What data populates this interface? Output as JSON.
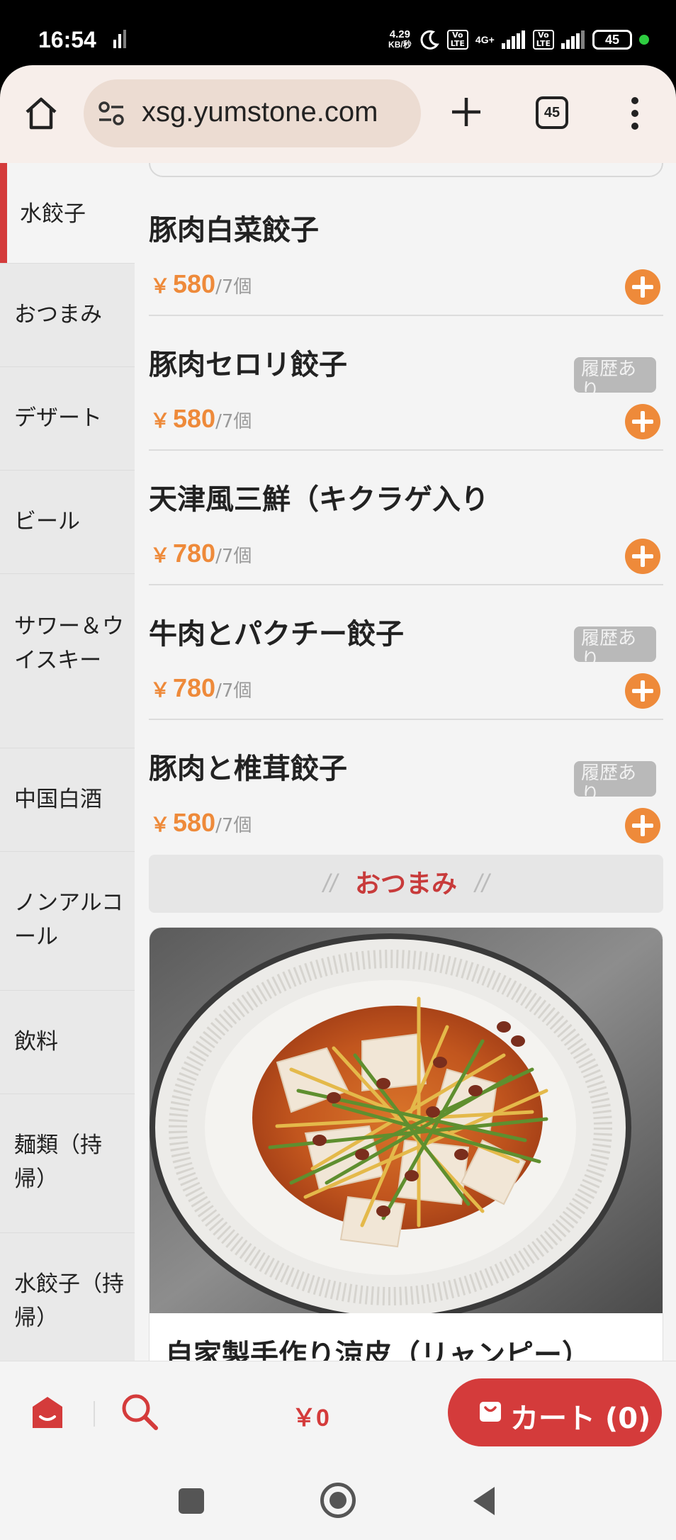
{
  "status_bar": {
    "time": "16:54",
    "net_speed_value": "4.29",
    "net_speed_unit": "KB/秒",
    "lte1": "Vo\nLTE",
    "network": "4G+",
    "lte2": "Vo\nLTE",
    "battery": "45"
  },
  "browser": {
    "url": "xsg.yumstone.com",
    "tab_count": "45"
  },
  "sidebar": {
    "items": [
      {
        "label": "水餃子"
      },
      {
        "label": "おつまみ"
      },
      {
        "label": "デザート"
      },
      {
        "label": "ビール"
      },
      {
        "label": "サワー＆ウイスキー"
      },
      {
        "label": "中国白酒"
      },
      {
        "label": "ノンアルコール"
      },
      {
        "label": "飲料"
      },
      {
        "label": "麺類（持帰）"
      },
      {
        "label": "水餃子（持帰）"
      }
    ]
  },
  "menu": {
    "currency": "￥",
    "items": [
      {
        "name": "豚肉白菜餃子",
        "price": "580",
        "unit": "/7個",
        "badge": ""
      },
      {
        "name": "豚肉セロリ餃子",
        "price": "580",
        "unit": "/7個",
        "badge": "履歴あり"
      },
      {
        "name": "天津風三鮮（キクラゲ入り",
        "price": "780",
        "unit": "/7個",
        "badge": ""
      },
      {
        "name": "牛肉とパクチー餃子",
        "price": "780",
        "unit": "/7個",
        "badge": "履歴あり"
      },
      {
        "name": "豚肉と椎茸餃子",
        "price": "580",
        "unit": "/7個",
        "badge": "履歴あり"
      }
    ],
    "section": {
      "slash_left": "//",
      "title": "おつまみ",
      "slash_right": "//"
    },
    "featured": {
      "name": "自家製手作り涼皮（リャンピー）"
    }
  },
  "bottom_bar": {
    "total": "￥0",
    "cart_label": "カート (0)"
  },
  "colors": {
    "accent_red": "#d43b3b",
    "price_orange": "#ee8a3a"
  }
}
